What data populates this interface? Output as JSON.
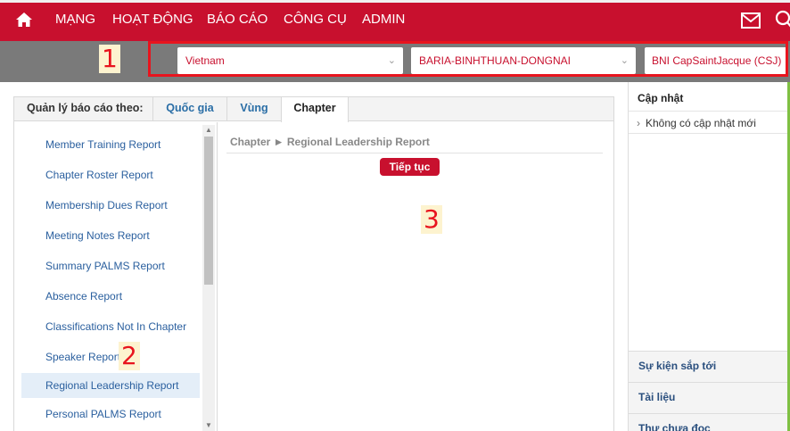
{
  "nav": {
    "items": [
      "MẠNG",
      "HOẠT ĐỘNG",
      "BÁO CÁO",
      "CÔNG CỤ",
      "ADMIN"
    ],
    "home_icon": "home-icon",
    "mail_icon": "mail-icon",
    "search_icon": "search-icon",
    "color": "#c8102e"
  },
  "filters": {
    "country": "Vietnam",
    "region": "BARIA-BINHTHUAN-DONGNAI",
    "chapter": "BNI CapSaintJacque (CSJ)"
  },
  "annotations": [
    "1",
    "2",
    "3"
  ],
  "tabs": {
    "label": "Quản lý báo cáo theo:",
    "items": [
      "Quốc gia",
      "Vùng",
      "Chapter"
    ],
    "active": "Chapter"
  },
  "reports": [
    "Member Training Report",
    "Chapter Roster Report",
    "Membership Dues Report",
    "Meeting Notes Report",
    "Summary PALMS Report",
    "Absence Report",
    "Classifications Not In Chapter",
    "Speaker Report",
    "Regional Leadership Report",
    "Personal PALMS Report"
  ],
  "selected_report": "Regional Leadership Report",
  "content": {
    "breadcrumb": "Chapter ► Regional Leadership Report",
    "continue_label": "Tiếp tục"
  },
  "sidebar": {
    "updates_title": "Cập nhật",
    "updates_item": "Không có cập nhật mới",
    "links": [
      "Sự kiện sắp tới",
      "Tài liệu",
      "Thư chưa đọc"
    ]
  }
}
